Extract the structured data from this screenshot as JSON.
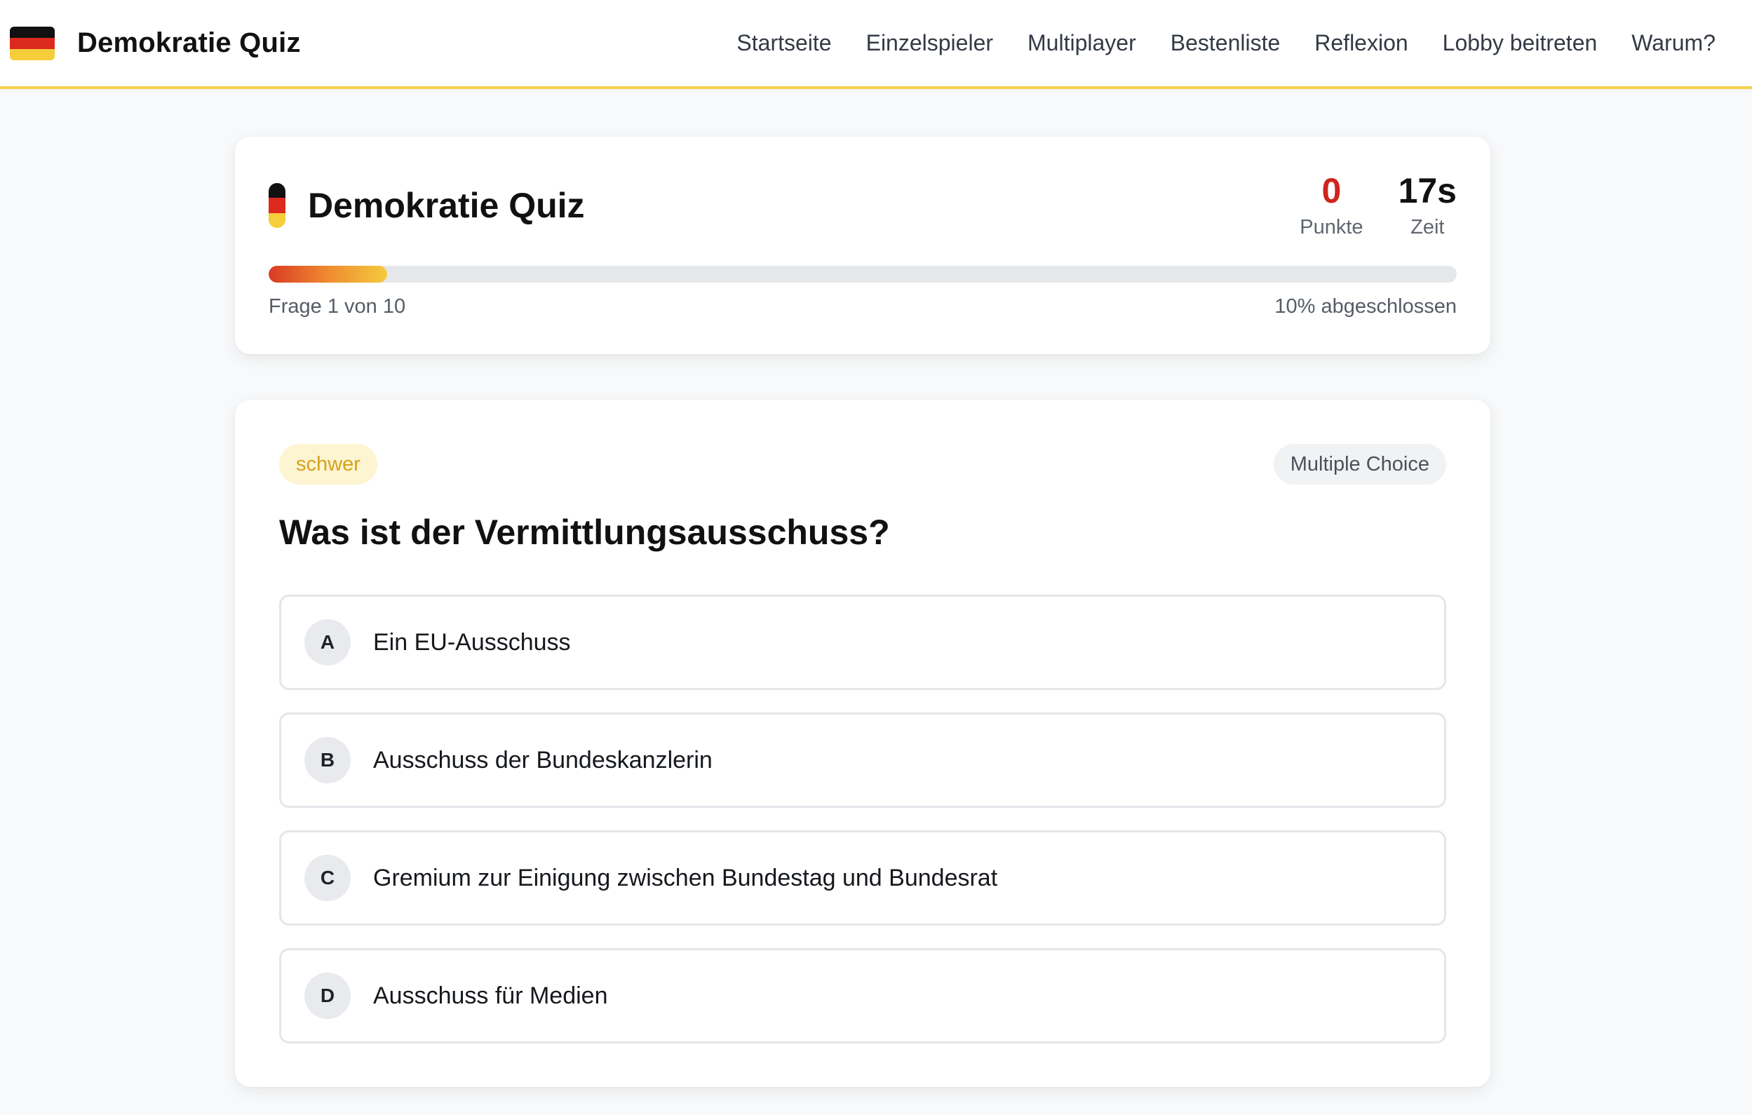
{
  "header": {
    "brand_title": "Demokratie Quiz",
    "flag_colors": [
      "#111111",
      "#dd2a1f",
      "#f6cd3a"
    ],
    "nav": [
      {
        "label": "Startseite"
      },
      {
        "label": "Einzelspieler"
      },
      {
        "label": "Multiplayer"
      },
      {
        "label": "Bestenliste"
      },
      {
        "label": "Reflexion"
      },
      {
        "label": "Lobby beitreten"
      },
      {
        "label": "Warum?"
      }
    ]
  },
  "status": {
    "title": "Demokratie Quiz",
    "points_value": "0",
    "points_label": "Punkte",
    "time_value": "17s",
    "time_label": "Zeit",
    "progress_percent": 10,
    "progress_text": "Frage 1 von 10",
    "progress_done_text": "10% abgeschlossen"
  },
  "question": {
    "difficulty": "schwer",
    "type": "Multiple Choice",
    "text": "Was ist der Vermittlungsausschuss?",
    "answers": [
      {
        "letter": "A",
        "text": "Ein EU-Ausschuss"
      },
      {
        "letter": "B",
        "text": "Ausschuss der Bundeskanzlerin"
      },
      {
        "letter": "C",
        "text": "Gremium zur Einigung zwischen Bundestag und Bundesrat"
      },
      {
        "letter": "D",
        "text": "Ausschuss für Medien"
      }
    ]
  },
  "colors": {
    "accent_yellow": "#f4d34f",
    "points_red": "#d0251c",
    "difficulty_bg": "#fdf4d1",
    "difficulty_text": "#d5a21b"
  }
}
